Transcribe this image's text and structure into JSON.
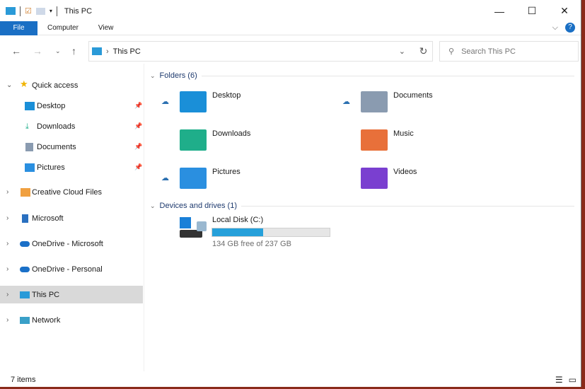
{
  "window": {
    "title": "This PC"
  },
  "ribbon": {
    "tabs": [
      "File",
      "Computer",
      "View"
    ]
  },
  "address": {
    "path": "This PC",
    "search_placeholder": "Search This PC"
  },
  "sidebar": {
    "items": [
      {
        "label": "Quick access",
        "icon": "star-icon",
        "pinned": false
      },
      {
        "label": "Desktop",
        "icon": "desktop-icon",
        "pinned": true
      },
      {
        "label": "Downloads",
        "icon": "download-icon",
        "pinned": true
      },
      {
        "label": "Documents",
        "icon": "documents-icon",
        "pinned": true
      },
      {
        "label": "Pictures",
        "icon": "pictures-icon",
        "pinned": true
      },
      {
        "label": "Creative Cloud Files",
        "icon": "creative-cloud-icon"
      },
      {
        "label": "Microsoft",
        "icon": "building-icon"
      },
      {
        "label": "OneDrive - Microsoft",
        "icon": "cloud-icon"
      },
      {
        "label": "OneDrive - Personal",
        "icon": "cloud-icon"
      },
      {
        "label": "This PC",
        "icon": "computer-icon",
        "selected": true
      },
      {
        "label": "Network",
        "icon": "network-icon"
      }
    ]
  },
  "folders": {
    "header": "Folders (6)",
    "items": [
      {
        "name": "Desktop",
        "color": "#1a8fd8",
        "cloud": true
      },
      {
        "name": "Documents",
        "color": "#8a9bb0",
        "cloud": true
      },
      {
        "name": "Downloads",
        "color": "#1fae8a",
        "cloud": false
      },
      {
        "name": "Music",
        "color": "#e8703a",
        "cloud": false
      },
      {
        "name": "Pictures",
        "color": "#2a8fe0",
        "cloud": true
      },
      {
        "name": "Videos",
        "color": "#7a3fd0",
        "cloud": false
      }
    ]
  },
  "drives": {
    "header": "Devices and drives (1)",
    "items": [
      {
        "name": "Local Disk (C:)",
        "free": "134 GB free of 237 GB",
        "used_fraction": 0.435
      }
    ]
  },
  "status": {
    "count": "7 items"
  }
}
